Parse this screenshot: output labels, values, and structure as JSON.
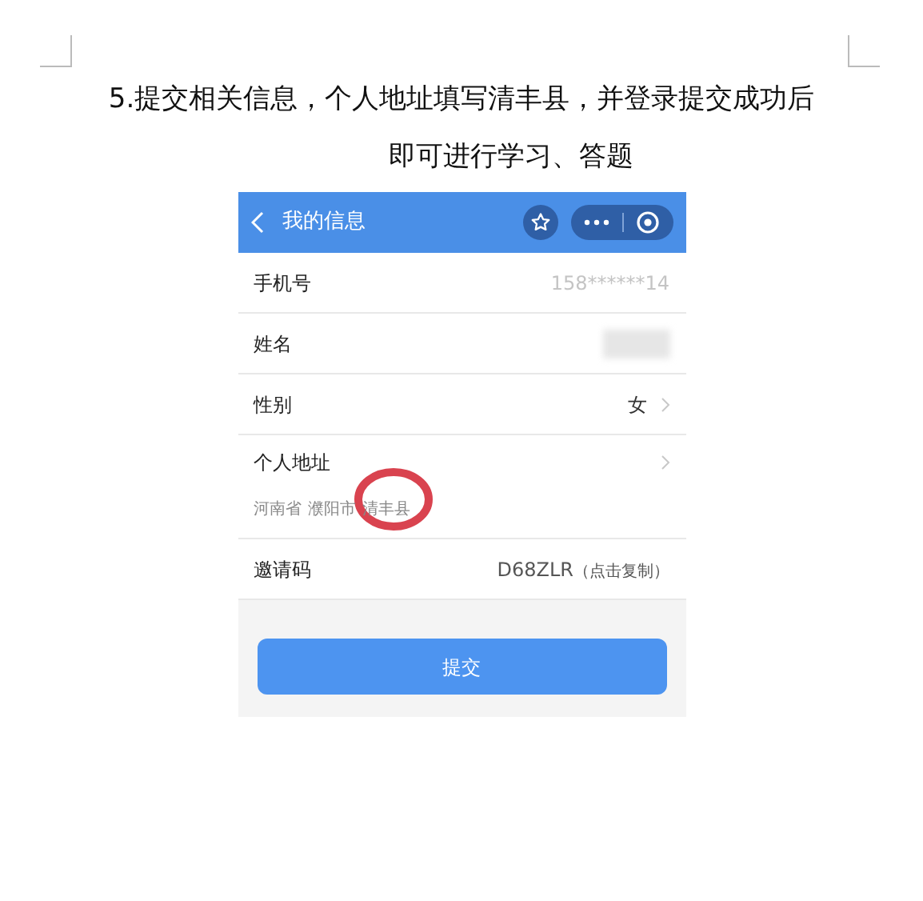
{
  "heading": [
    "5.提交相关信息，个人地址填写清丰县，并登录提交成功后",
    "即可进行学习、答题"
  ],
  "app": {
    "title": "我的信息",
    "rows": [
      {
        "kind": "text",
        "label": "手机号",
        "value": "158******14",
        "chevron": false
      },
      {
        "kind": "redacted",
        "label": "姓名",
        "chevron": false
      },
      {
        "kind": "text",
        "label": "性别",
        "value": "女",
        "chevron": true
      },
      {
        "kind": "address",
        "label": "个人地址",
        "chevron": true,
        "parts": [
          {
            "text": "河南省",
            "circled": false
          },
          {
            "text": "濮阳市",
            "circled": false
          },
          {
            "text": "清丰县",
            "circled": true
          }
        ]
      },
      {
        "kind": "copy",
        "label": "邀请码",
        "value": "D68ZLR",
        "hint": "（点击复制）",
        "chevron": false
      }
    ],
    "submit": "提交"
  }
}
